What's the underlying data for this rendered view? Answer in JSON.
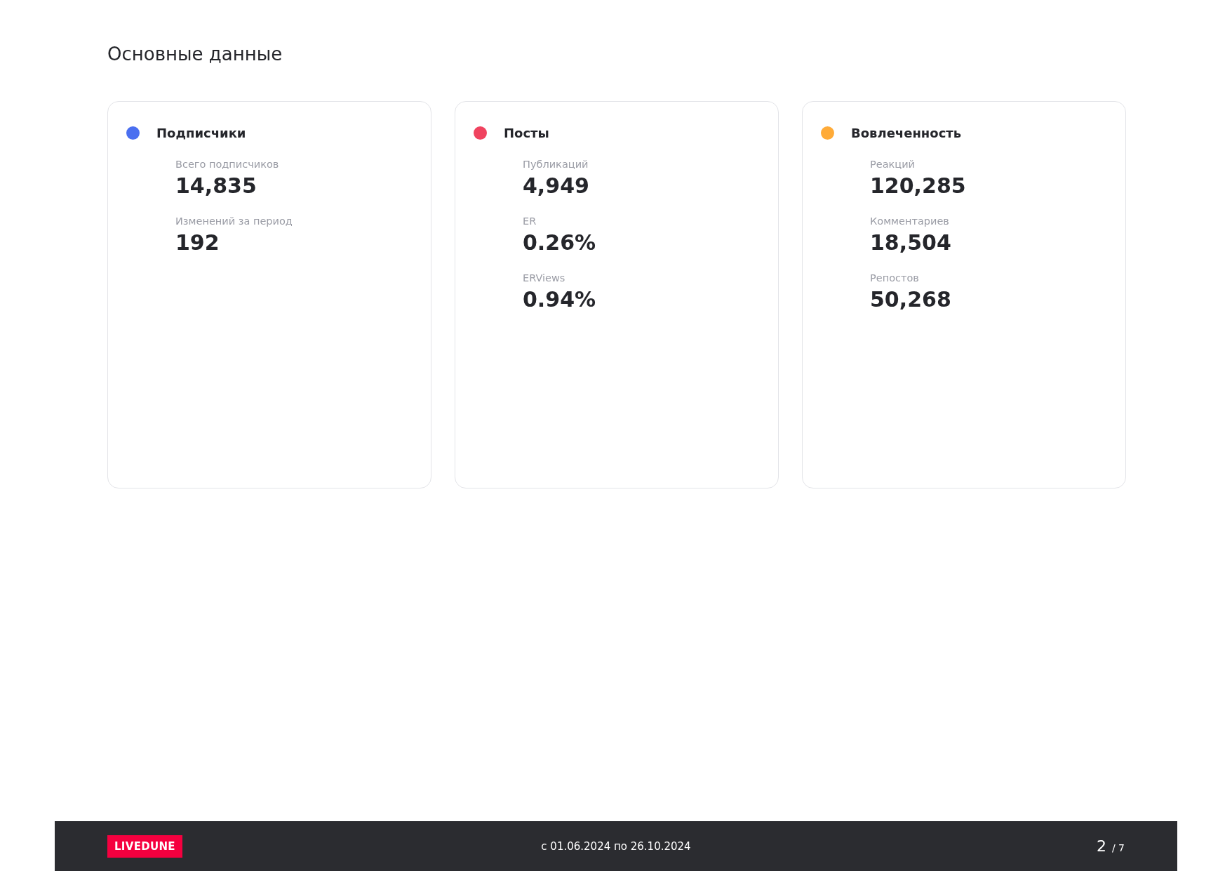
{
  "title": "Основные данные",
  "cards": [
    {
      "title": "Подписчики",
      "color": "#4a6ff0",
      "metrics": [
        {
          "label": "Всего подписчиков",
          "value": "14,835"
        },
        {
          "label": "Изменений за период",
          "value": "192"
        }
      ]
    },
    {
      "title": "Посты",
      "color": "#f0435f",
      "metrics": [
        {
          "label": "Публикаций",
          "value": "4,949"
        },
        {
          "label": "ER",
          "value": "0.26%"
        },
        {
          "label": "ERViews",
          "value": "0.94%"
        }
      ]
    },
    {
      "title": "Вовлеченность",
      "color": "#ffab38",
      "metrics": [
        {
          "label": "Реакций",
          "value": "120,285"
        },
        {
          "label": "Комментариев",
          "value": "18,504"
        },
        {
          "label": "Репостов",
          "value": "50,268"
        }
      ]
    }
  ],
  "footer": {
    "logo": "LIVEDUNE",
    "period": "с 01.06.2024 по 26.10.2024",
    "page": "2",
    "total": "/ 7"
  }
}
